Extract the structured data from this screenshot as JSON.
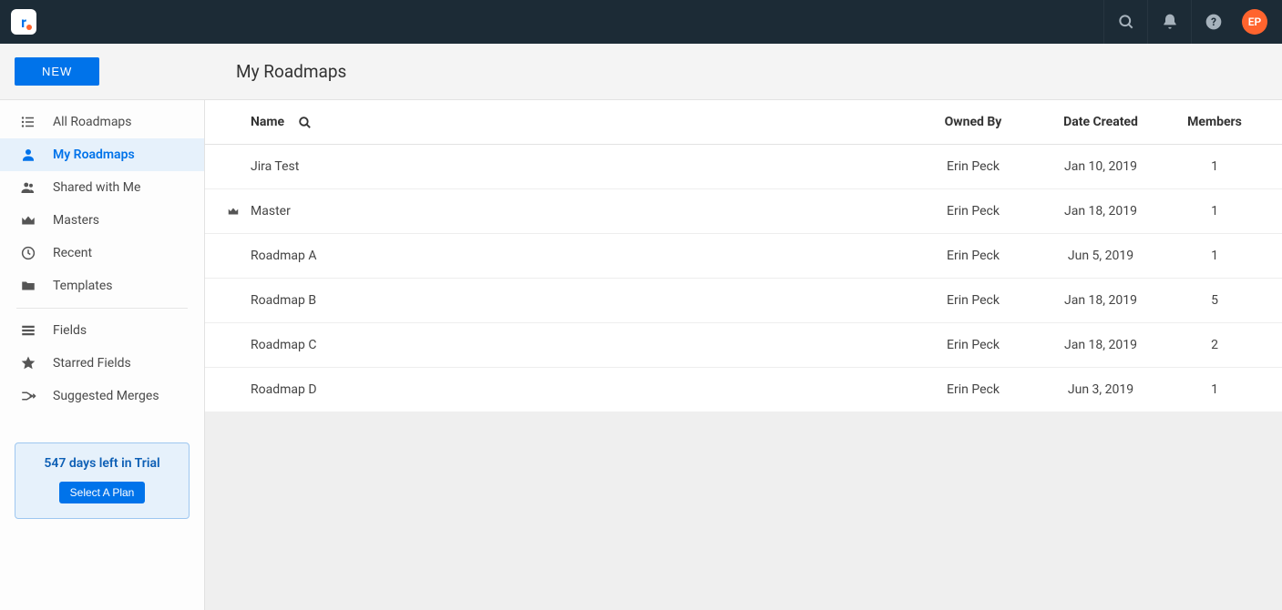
{
  "header": {
    "avatar_initials": "EP"
  },
  "subbar": {
    "new_button": "NEW",
    "page_title": "My Roadmaps"
  },
  "sidebar": {
    "items": [
      {
        "label": "All Roadmaps"
      },
      {
        "label": "My Roadmaps"
      },
      {
        "label": "Shared with Me"
      },
      {
        "label": "Masters"
      },
      {
        "label": "Recent"
      },
      {
        "label": "Templates"
      }
    ],
    "items2": [
      {
        "label": "Fields"
      },
      {
        "label": "Starred Fields"
      },
      {
        "label": "Suggested Merges"
      }
    ],
    "trial_line": "547 days left in Trial",
    "plan_button": "Select A Plan"
  },
  "table": {
    "columns": {
      "name": "Name",
      "owner": "Owned By",
      "date": "Date Created",
      "members": "Members"
    },
    "rows": [
      {
        "name": "Jira Test",
        "owner": "Erin Peck",
        "date": "Jan 10, 2019",
        "members": "1",
        "master": false
      },
      {
        "name": "Master",
        "owner": "Erin Peck",
        "date": "Jan 18, 2019",
        "members": "1",
        "master": true
      },
      {
        "name": "Roadmap A",
        "owner": "Erin Peck",
        "date": "Jun 5, 2019",
        "members": "1",
        "master": false
      },
      {
        "name": "Roadmap B",
        "owner": "Erin Peck",
        "date": "Jan 18, 2019",
        "members": "5",
        "master": false
      },
      {
        "name": "Roadmap C",
        "owner": "Erin Peck",
        "date": "Jan 18, 2019",
        "members": "2",
        "master": false
      },
      {
        "name": "Roadmap D",
        "owner": "Erin Peck",
        "date": "Jun 3, 2019",
        "members": "1",
        "master": false
      }
    ]
  }
}
